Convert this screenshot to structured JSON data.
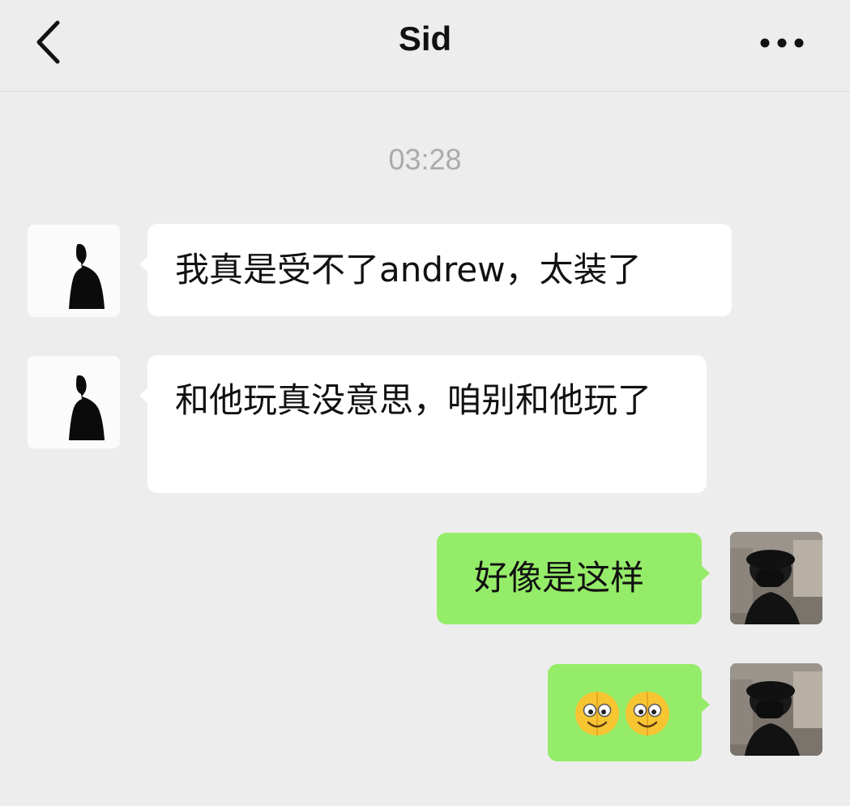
{
  "header": {
    "title": "Sid",
    "back_icon": "chevron-left-icon",
    "more_icon": "ellipsis-icon"
  },
  "timestamp": "03:28",
  "messages": [
    {
      "side": "in",
      "text": "我真是受不了andrew，太装了"
    },
    {
      "side": "in",
      "text": "和他玩真没意思，咱别和他玩了"
    },
    {
      "side": "out",
      "text": "好像是这样"
    },
    {
      "side": "out",
      "text": "",
      "emoji": [
        "woozy-smile-emoji",
        "woozy-smile-emoji"
      ]
    }
  ],
  "colors": {
    "background": "#ededed",
    "incoming_bubble": "#ffffff",
    "outgoing_bubble": "#95ec69",
    "timestamp": "#ababab"
  }
}
